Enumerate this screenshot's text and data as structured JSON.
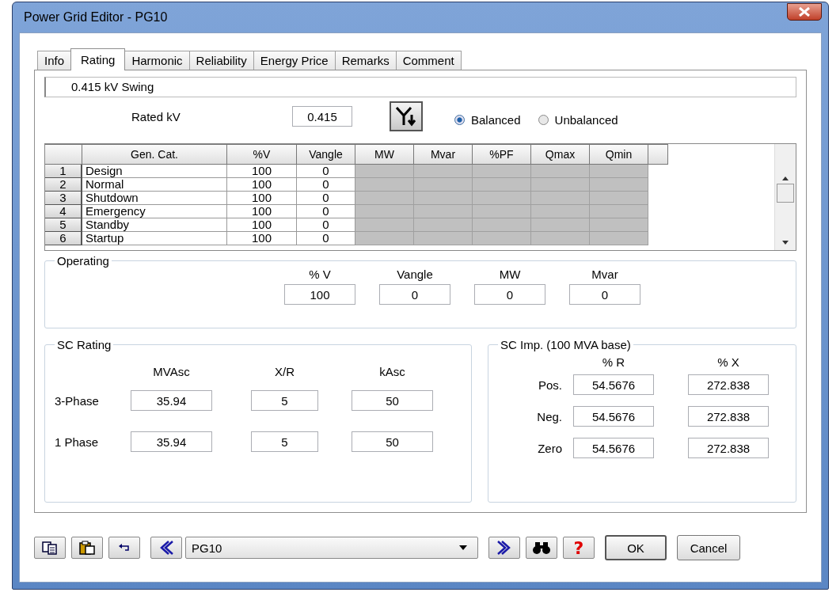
{
  "window": {
    "title": "Power Grid Editor - PG10"
  },
  "tabs": [
    {
      "label": "Info",
      "selected": false
    },
    {
      "label": "Rating",
      "selected": true
    },
    {
      "label": "Harmonic",
      "selected": false
    },
    {
      "label": "Reliability",
      "selected": false
    },
    {
      "label": "Energy Price",
      "selected": false
    },
    {
      "label": "Remarks",
      "selected": false
    },
    {
      "label": "Comment",
      "selected": false
    }
  ],
  "info_line": "0.415 kV  Swing",
  "rated_kv": {
    "label": "Rated kV",
    "value": "0.415"
  },
  "balance_options": [
    {
      "label": "Balanced",
      "selected": true
    },
    {
      "label": "Unbalanced",
      "selected": false
    }
  ],
  "table": {
    "columns": [
      {
        "label": "Gen. Cat.",
        "disabled": false
      },
      {
        "label": "%V",
        "disabled": false
      },
      {
        "label": "Vangle",
        "disabled": false
      },
      {
        "label": "MW",
        "disabled": true
      },
      {
        "label": "Mvar",
        "disabled": true
      },
      {
        "label": "%PF",
        "disabled": true
      },
      {
        "label": "Qmax",
        "disabled": true
      },
      {
        "label": "Qmin",
        "disabled": true
      }
    ],
    "rows": [
      {
        "number": "1",
        "cells": [
          "Design",
          "100",
          "0"
        ]
      },
      {
        "number": "2",
        "cells": [
          "Normal",
          "100",
          "0"
        ]
      },
      {
        "number": "3",
        "cells": [
          "Shutdown",
          "100",
          "0"
        ]
      },
      {
        "number": "4",
        "cells": [
          "Emergency",
          "100",
          "0"
        ]
      },
      {
        "number": "5",
        "cells": [
          "Standby",
          "100",
          "0"
        ]
      },
      {
        "number": "6",
        "cells": [
          "Startup",
          "100",
          "0"
        ]
      }
    ]
  },
  "operating": {
    "title": "Operating",
    "fields": [
      {
        "label": "% V",
        "value": "100"
      },
      {
        "label": "Vangle",
        "value": "0"
      },
      {
        "label": "MW",
        "value": "0"
      },
      {
        "label": "Mvar",
        "value": "0"
      }
    ]
  },
  "sc_rating": {
    "title": "SC Rating",
    "columns": [
      "MVAsc",
      "X/R",
      "kAsc"
    ],
    "rows": [
      {
        "label": "3-Phase",
        "values": [
          "35.94",
          "5",
          "50"
        ]
      },
      {
        "label": "1 Phase",
        "values": [
          "35.94",
          "5",
          "50"
        ]
      }
    ]
  },
  "sc_impedance": {
    "title": "SC Imp. (100 MVA base)",
    "columns": [
      "% R",
      "% X"
    ],
    "rows": [
      {
        "label": "Pos.",
        "values": [
          "54.5676",
          "272.838"
        ]
      },
      {
        "label": "Neg.",
        "values": [
          "54.5676",
          "272.838"
        ]
      },
      {
        "label": "Zero",
        "values": [
          "54.5676",
          "272.838"
        ]
      }
    ]
  },
  "footer": {
    "selector": "PG10",
    "help": "?",
    "ok": "OK",
    "cancel": "Cancel"
  }
}
